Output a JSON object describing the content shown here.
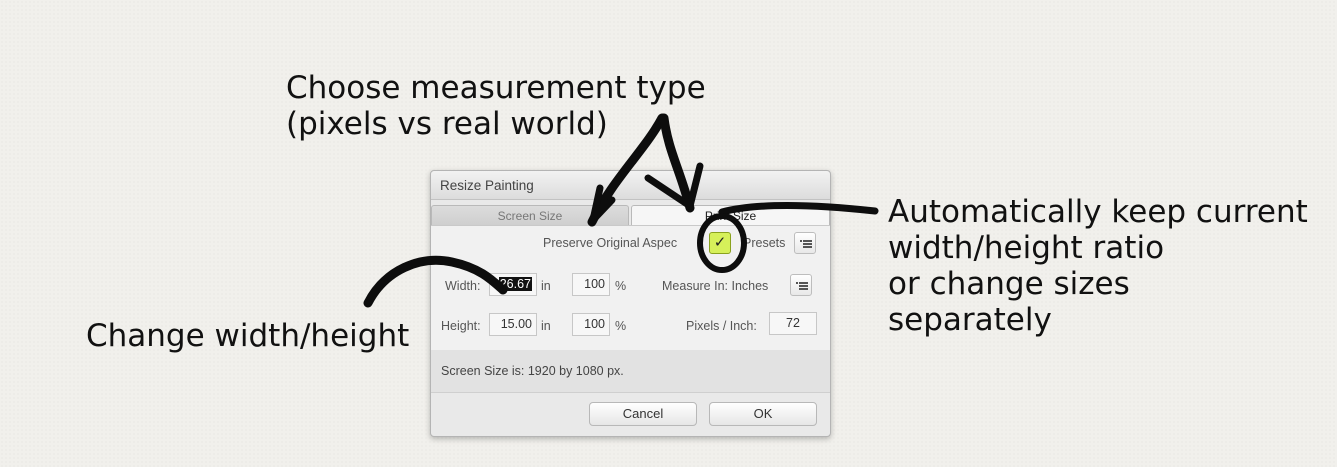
{
  "annotations": {
    "measurement": "Choose measurement type\n(pixels vs real world)",
    "change_size": "Change width/height",
    "aspect": "Automatically keep current\nwidth/height ratio\nor change sizes\nseparately"
  },
  "dialog": {
    "title": "Resize Painting",
    "tabs": {
      "screen": "Screen Size",
      "print": "Print Size"
    },
    "preserve_label": "Preserve Original Aspec",
    "preserve_checked": "✓",
    "presets_label": "Presets",
    "width_label": "Width:",
    "width_value": "26.67",
    "width_unit": "in",
    "width_percent": "100",
    "percent_sign": "%",
    "height_label": "Height:",
    "height_value": "15.00",
    "height_unit": "in",
    "height_percent": "100",
    "measure_label": "Measure In: Inches",
    "ppi_label": "Pixels / Inch:",
    "ppi_value": "72",
    "screen_size_info": "Screen Size is: 1920 by 1080 px.",
    "cancel": "Cancel",
    "ok": "OK"
  },
  "colors": {
    "checkbox_bg": "#d6f05a",
    "annotation_ink": "#111111"
  },
  "icons": [
    "menu-icon",
    "checkmark-icon"
  ]
}
